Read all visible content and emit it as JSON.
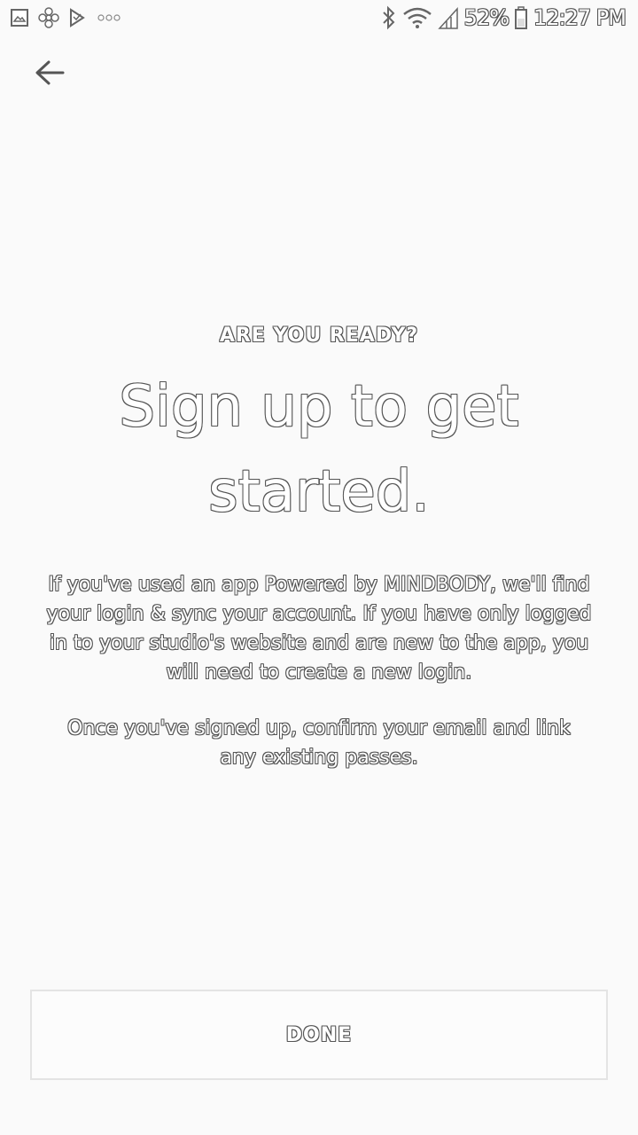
{
  "status_bar": {
    "left_icons": [
      "image-icon",
      "pinwheel-icon",
      "check-flag-icon",
      "more-dots-icon"
    ],
    "right_icons": [
      "bluetooth-icon",
      "wifi-icon",
      "signal-icon",
      "battery-icon"
    ],
    "battery": "52%",
    "time": "12:27 PM"
  },
  "nav": {
    "back_icon": "arrow-left-icon"
  },
  "content": {
    "eyebrow": "ARE YOU READY?",
    "headline": "Sign up to get started.",
    "paragraph1": "If you've used an app Powered by MINDBODY, we'll find your login & sync your account. If you have only logged in to your studio's website and are new to the app, you will need to create a new login.",
    "paragraph2": "Once you've signed up, confirm your email and link any existing passes."
  },
  "actions": {
    "done_label": "DONE"
  },
  "colors": {
    "background": "#fafafa",
    "text_fill": "#ffffff",
    "text_outline": "#555555",
    "button_border": "#e4e4e4"
  }
}
